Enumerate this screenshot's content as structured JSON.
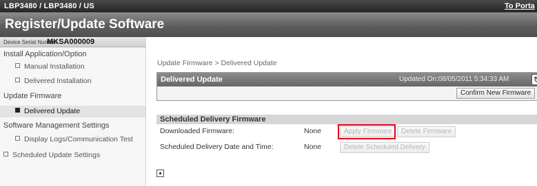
{
  "topbar": {
    "model": "LBP3480 / LBP3480 / US",
    "portal_link": "To Porta"
  },
  "title": "Register/Update Software",
  "device": {
    "serial_label": "Device Serial Number:",
    "serial_value": "MKSA000009"
  },
  "sidebar": {
    "install_heading": "Install Application/Option",
    "manual_installation": "Manual Installation",
    "delivered_installation": "Delivered Installation",
    "update_heading": "Update Firmware",
    "delivered_update": "Delivered Update",
    "software_heading": "Software Management Settings",
    "display_logs": "Display Logs/Communication Test",
    "scheduled_update": "Scheduled Update Settings"
  },
  "breadcrumb": "Update Firmware > Delivered Update",
  "delivered_panel": {
    "title": "Delivered Update",
    "updated_on": "Updated On:08/05/2011 5:34:33 AM",
    "confirm_button": "Confirm New Firmware"
  },
  "scheduled": {
    "title": "Scheduled Delivery Firmware",
    "downloaded_label": "Downloaded Firmware:",
    "downloaded_value": "None",
    "apply_button": "Apply Firmware",
    "delete_button": "Delete Firmware",
    "schedule_label": "Scheduled Delivery Date and Time:",
    "schedule_value": "None",
    "delete_schedule_button": "Delete Scheduled Delivery"
  },
  "icons": {
    "refresh": "refresh-icon",
    "collapse": "collapse-up-icon"
  },
  "colors": {
    "highlight": "#e0001a",
    "header_dark": "#262626"
  }
}
